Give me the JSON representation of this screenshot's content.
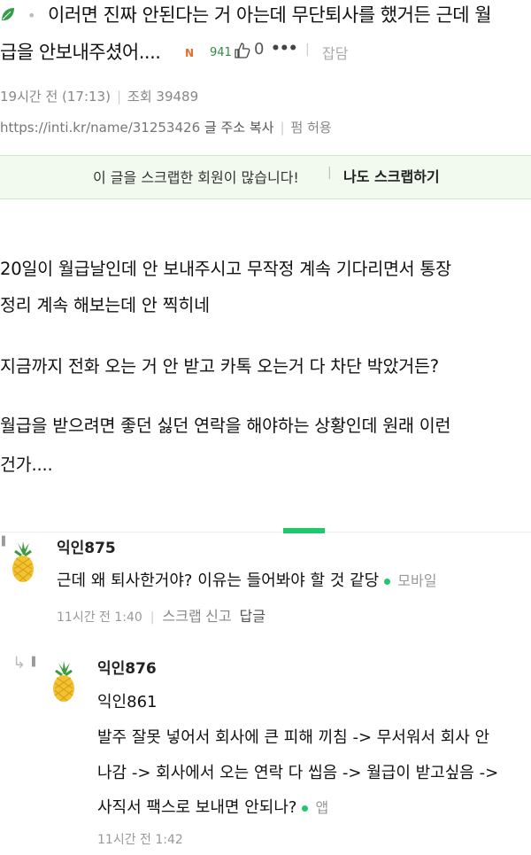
{
  "post": {
    "title_line1": "이러면 진짜 안된다는 거 아는데 무단퇴사를 했거든 근데 월",
    "title_line2": "급을 안보내주셨어....",
    "badge": "N",
    "small_views": "941",
    "likes": "0",
    "category": "잡담",
    "time": "19시간 전 (17:13)",
    "views_label": "조회 39489",
    "url": "https://inti.kr/name/31253426",
    "copy_url_label": "글 주소 복사",
    "perm_label": "펌 허용"
  },
  "scrap_banner": {
    "message": "이 글을 스크랩한 회원이 많습니다!",
    "button": "나도 스크랩하기"
  },
  "body": {
    "p1_line1": "20일이 월급날인데 안 보내주시고 무작정 계속 기다리면서 통장",
    "p1_line2": "정리 계속 해보는데 안 찍히네",
    "p2": "지금까지 전화 오는 거 안 받고 카톡 오는거 다 차단 박았거든?",
    "p3_line1": "월급을 받으려면 좋던 싫던 연락을 해야하는 상황인데 원래 이런",
    "p3_line2": "건가...."
  },
  "comments": [
    {
      "name": "익인875",
      "text": "근데 왜 퇴사한거야? 이유는 들어봐야 할 것 같당",
      "source": "모바일",
      "time": "11시간 전 1:40",
      "actions": [
        "스크랩",
        "신고",
        "답글"
      ]
    },
    {
      "name": "익인876",
      "mention": "익인861",
      "text_line1": "발주 잘못 넣어서 회사에 큰 피해 끼침 -> 무서워서 회사 안",
      "text_line2": "나감 -> 회사에서 오는 연락 다 씹음 -> 월급이 받고싶음 ->",
      "text_line3": "사직서 팩스로 보내면 안되나?",
      "source": "앱",
      "time": "11시간 전 1:42"
    }
  ],
  "colors": {
    "accent_green": "#1ec96b",
    "banner_bg": "#f2faf0",
    "badge_orange": "#e76c2d"
  },
  "icons": [
    "leaf-icon",
    "like-icon",
    "more-icon",
    "flag-icon",
    "pineapple-avatar-icon",
    "reply-arrow-icon"
  ]
}
